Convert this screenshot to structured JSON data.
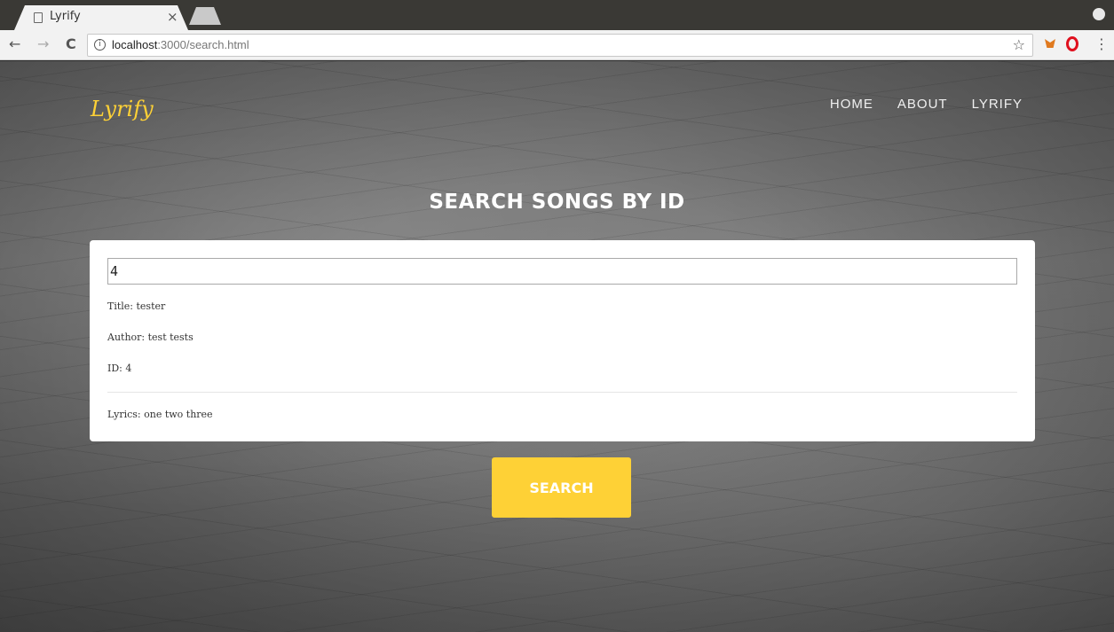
{
  "browser": {
    "tab_title": "Lyrify",
    "tab_close": "×",
    "url_host": "localhost",
    "url_rest": ":3000/search.html",
    "back": "←",
    "forward": "→",
    "reload": "C",
    "star": "☆",
    "menu": "⋮",
    "info": "i"
  },
  "site": {
    "brand": "Lyrify",
    "nav": [
      "HOME",
      "ABOUT",
      "LYRIFY"
    ]
  },
  "main": {
    "heading": "SEARCH SONGS BY ID",
    "search_value": "4",
    "result": {
      "title": "Title: tester",
      "author": "Author: test tests",
      "id": "ID: 4",
      "lyrics": "Lyrics: one two three"
    },
    "search_button": "SEARCH"
  },
  "colors": {
    "accent": "#fed136"
  }
}
